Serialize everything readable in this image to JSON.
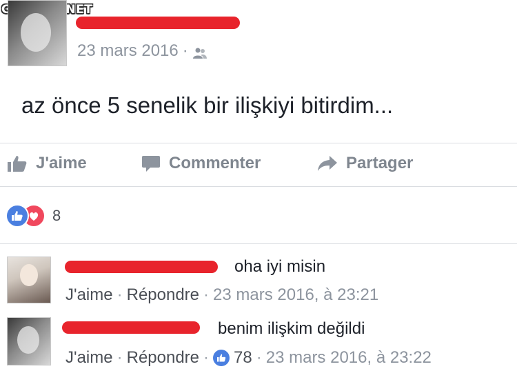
{
  "watermark": "GULDUM.NET",
  "post": {
    "date": "23 mars 2016",
    "separator": "·",
    "audience_icon": "friends-icon",
    "text": "az önce 5 senelik bir ilişkiyi bitirdim..."
  },
  "actions": {
    "like_label": "J'aime",
    "comment_label": "Commenter",
    "share_label": "Partager"
  },
  "reactions": {
    "icons": [
      "like-reaction-icon",
      "love-reaction-icon"
    ],
    "count": "8"
  },
  "comments": [
    {
      "text": "oha iyi misin",
      "like_label": "J'aime",
      "reply_label": "Répondre",
      "separator": "·",
      "timestamp": "23 mars 2016, à 23:21"
    },
    {
      "text": "benim ilişkim değildi",
      "like_label": "J'aime",
      "reply_label": "Répondre",
      "separator": "·",
      "like_count": "78",
      "timestamp": "23 mars 2016, à 23:22"
    }
  ],
  "colors": {
    "redaction": "#e8242c",
    "like_blue": "#4a7fe0",
    "love_red": "#f0485d",
    "meta_gray": "#8d949e"
  }
}
